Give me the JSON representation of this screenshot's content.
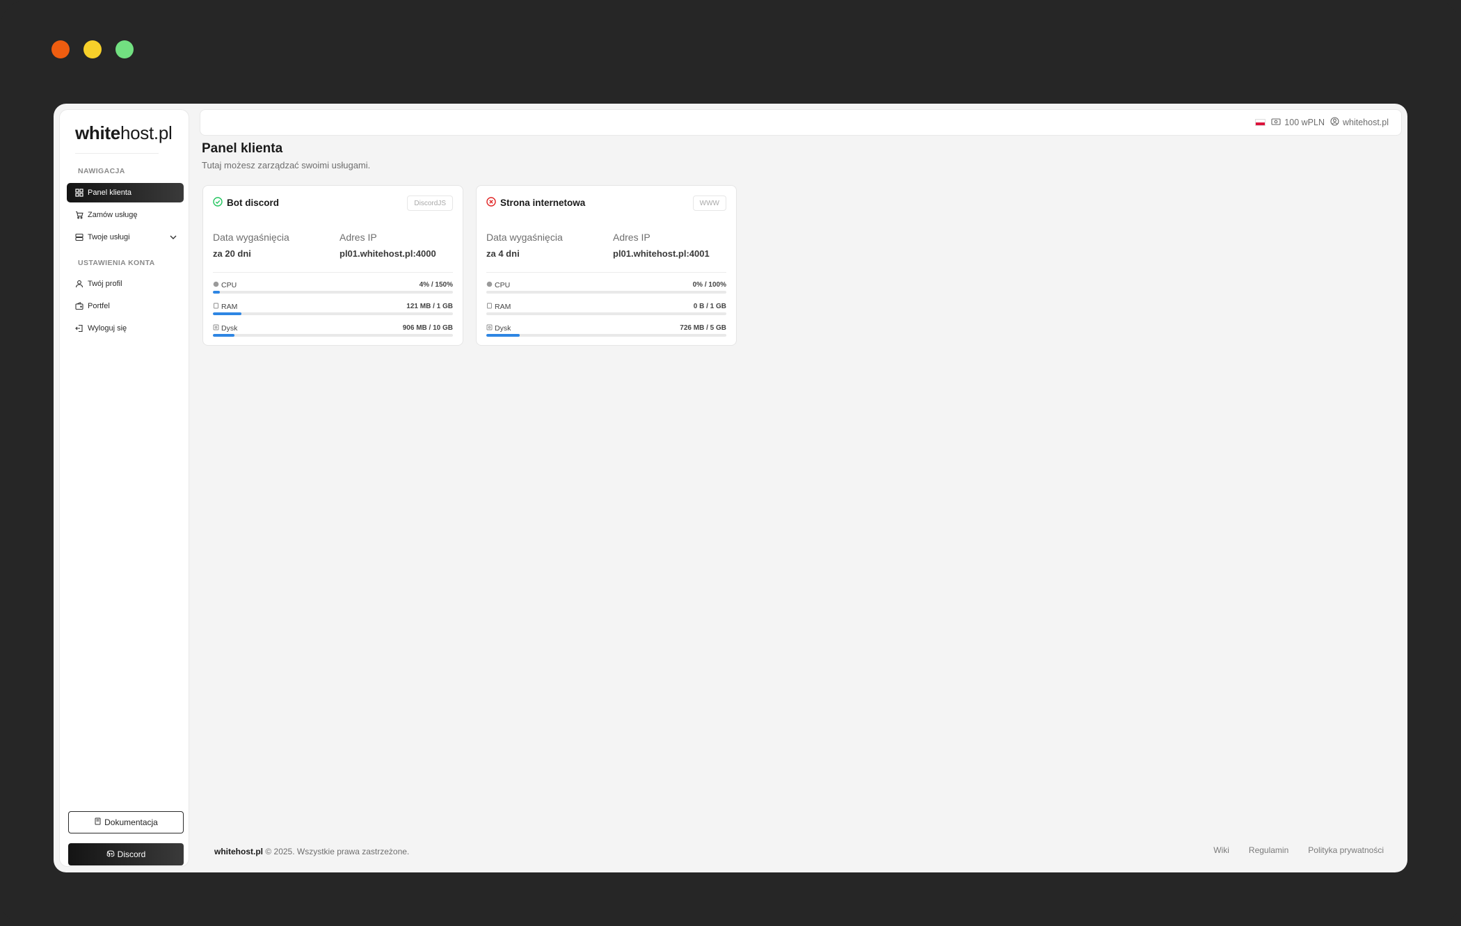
{
  "brand": {
    "bold": "white",
    "rest": "host.pl"
  },
  "sidebar": {
    "sections": [
      {
        "label": "NAWIGACJA"
      },
      {
        "label": "USTAWIENIA KONTA"
      }
    ],
    "items": [
      {
        "label": "Panel klienta",
        "icon": "dashboard-icon",
        "active": true
      },
      {
        "label": "Zamów usługę",
        "icon": "cart-icon"
      },
      {
        "label": "Twoje usługi",
        "icon": "server-icon"
      },
      {
        "label": "Twój profil",
        "icon": "user-icon"
      },
      {
        "label": "Portfel",
        "icon": "wallet-icon"
      },
      {
        "label": "Wyloguj się",
        "icon": "logout-icon"
      }
    ],
    "doc_button": "Dokumentacja",
    "discord_button": "Discord"
  },
  "topbar": {
    "balance": "100 wPLN",
    "username": "whitehost.pl"
  },
  "main": {
    "title": "Panel klienta",
    "subtitle": "Tutaj możesz zarządzać swoimi usługami."
  },
  "services": [
    {
      "name": "Bot discord",
      "status": "online",
      "badge": "DiscordJS",
      "expiry_label": "Data wygaśnięcia",
      "expiry_value": "za 20 dni",
      "ip_label": "Adres IP",
      "ip_value": "pl01.whitehost.pl:4000",
      "resources": [
        {
          "label": "CPU",
          "value": "4% / 150%",
          "percent": 3
        },
        {
          "label": "RAM",
          "value": "121 MB / 1 GB",
          "percent": 12
        },
        {
          "label": "Dysk",
          "value": "906 MB / 10 GB",
          "percent": 9
        }
      ]
    },
    {
      "name": "Strona internetowa",
      "status": "offline",
      "badge": "WWW",
      "expiry_label": "Data wygaśnięcia",
      "expiry_value": "za 4 dni",
      "ip_label": "Adres IP",
      "ip_value": "pl01.whitehost.pl:4001",
      "resources": [
        {
          "label": "CPU",
          "value": "0% / 100%",
          "percent": 0
        },
        {
          "label": "RAM",
          "value": "0 B / 1 GB",
          "percent": 0
        },
        {
          "label": "Dysk",
          "value": "726 MB / 5 GB",
          "percent": 14
        }
      ]
    }
  ],
  "footer": {
    "brand": "whitehost.pl",
    "copyright": "© 2025. Wszystkie prawa zastrzeżone.",
    "links": [
      "Wiki",
      "Regulamin",
      "Polityka prywatności"
    ]
  },
  "colors": {
    "accent": "#2e86e3",
    "online": "#22c55e",
    "offline": "#e02424",
    "sidebar_active": "#1a1a1a"
  }
}
